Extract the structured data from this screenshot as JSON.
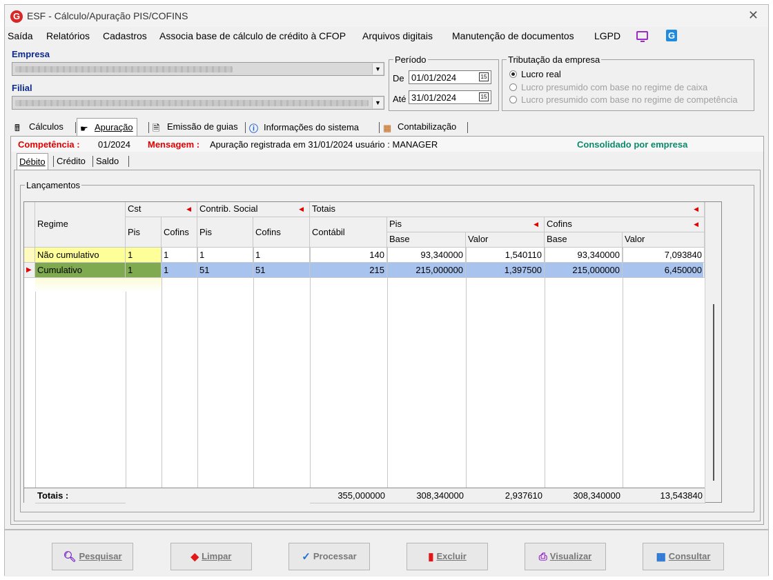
{
  "window": {
    "title": "ESF - Cálculo/Apuração PIS/COFINS",
    "close_glyph": "✕"
  },
  "menu": [
    "Saída",
    "Relatórios",
    "Cadastros",
    "Associa base de cálculo de crédito à CFOP",
    "Arquivos digitais",
    "Manutenção de documentos",
    "LGPD"
  ],
  "empresa": {
    "label": "Empresa"
  },
  "filial": {
    "label": "Filial"
  },
  "periodo": {
    "legend": "Período",
    "de_label": "De",
    "de_value": "01/01/2024",
    "ate_label": "Até",
    "ate_value": "31/01/2024"
  },
  "tributacao": {
    "legend": "Tributação da empresa",
    "options": [
      {
        "label": "Lucro real",
        "selected": true
      },
      {
        "label": "Lucro presumido com base no regime de caixa",
        "selected": false
      },
      {
        "label": "Lucro presumido com base no regime de competência",
        "selected": false
      }
    ]
  },
  "tabs": [
    "Cálculos",
    "Apuração",
    "Emissão de guias",
    "Informações do sistema",
    "Contabilização"
  ],
  "info": {
    "competencia_label": "Competência :",
    "competencia_value": "01/2024",
    "mensagem_label": "Mensagem :",
    "mensagem_value": "Apuração registrada em 31/01/2024 usuário : MANAGER",
    "status": "Consolidado por empresa"
  },
  "subtabs": [
    "Débito",
    "Crédito",
    "Saldo"
  ],
  "lancamentos": {
    "legend": "Lançamentos",
    "headers": {
      "regime": "Regime",
      "cst": "Cst",
      "contrib": "Contrib. Social",
      "totais": "Totais",
      "pis": "Pis",
      "cofins": "Cofins",
      "contabil": "Contábil",
      "base": "Base",
      "valor": "Valor"
    },
    "rows": [
      {
        "regime": "Não cumulativo",
        "cst_pis": "1",
        "cst_cofins": "1",
        "cs_pis": "1",
        "cs_cofins": "1",
        "contabil": "140",
        "pis_base": "93,340000",
        "pis_valor": "1,540110",
        "cofins_base": "93,340000",
        "cofins_valor": "7,093840"
      },
      {
        "regime": "Cumulativo",
        "cst_pis": "1",
        "cst_cofins": "1",
        "cs_pis": "51",
        "cs_cofins": "51",
        "contabil": "215",
        "pis_base": "215,000000",
        "pis_valor": "1,397500",
        "cofins_base": "215,000000",
        "cofins_valor": "6,450000"
      }
    ],
    "totals": {
      "label": "Totais :",
      "contabil": "355,000000",
      "pis_base": "308,340000",
      "pis_valor": "2,937610",
      "cofins_base": "308,340000",
      "cofins_valor": "13,543840"
    }
  },
  "buttons": [
    "Pesquisar",
    "Limpar",
    "Processar",
    "Excluir",
    "Visualizar",
    "Consultar"
  ]
}
